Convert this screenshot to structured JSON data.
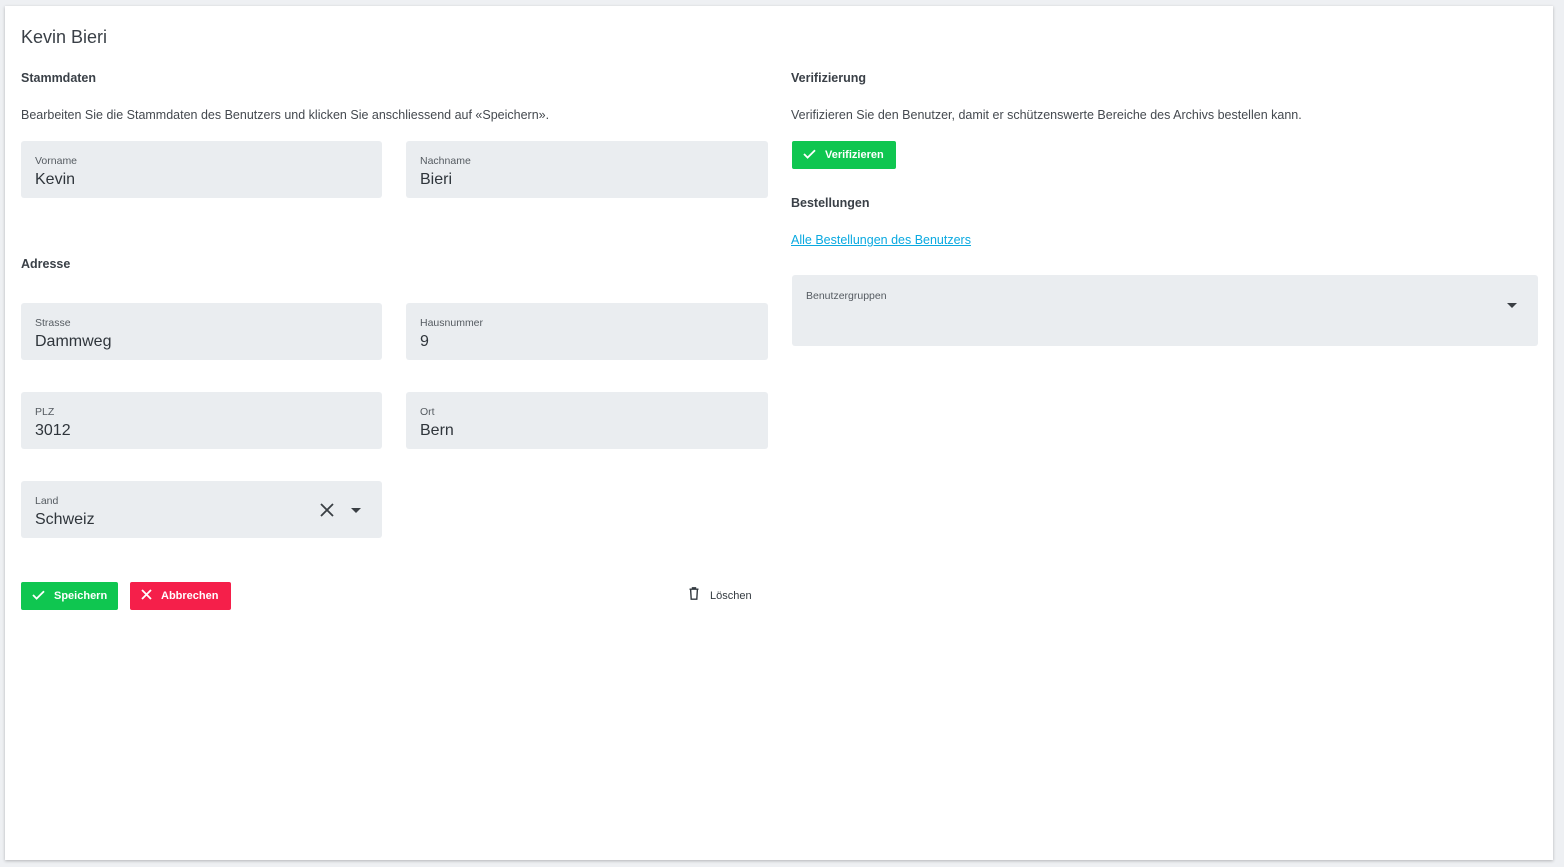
{
  "page": {
    "title": "Kevin Bieri"
  },
  "stammdaten": {
    "heading": "Stammdaten",
    "description": "Bearbeiten Sie die Stammdaten des Benutzers und klicken Sie anschliessend auf «Speichern».",
    "vorname": {
      "label": "Vorname",
      "value": "Kevin"
    },
    "nachname": {
      "label": "Nachname",
      "value": "Bieri"
    }
  },
  "adresse": {
    "heading": "Adresse",
    "strasse": {
      "label": "Strasse",
      "value": "Dammweg"
    },
    "hausnummer": {
      "label": "Hausnummer",
      "value": "9"
    },
    "plz": {
      "label": "PLZ",
      "value": "3012"
    },
    "ort": {
      "label": "Ort",
      "value": "Bern"
    },
    "land": {
      "label": "Land",
      "value": "Schweiz"
    }
  },
  "actions": {
    "save_label": "Speichern",
    "cancel_label": "Abbrechen",
    "delete_label": "Löschen"
  },
  "verifizierung": {
    "heading": "Verifizierung",
    "description": "Verifizieren Sie den Benutzer, damit er schützenswerte Bereiche des Archivs bestellen kann.",
    "button_label": "Verifizieren"
  },
  "bestellungen": {
    "heading": "Bestellungen",
    "link_label": "Alle Bestellungen des Benutzers"
  },
  "benutzergruppen": {
    "label": "Benutzergruppen",
    "value": ""
  },
  "colors": {
    "success": "#0fc650",
    "danger": "#f51f4a",
    "link": "#0aa9e0",
    "field_bg": "#eaedf0"
  },
  "icons": [
    "check-icon",
    "close-icon",
    "trash-icon",
    "chevron-down-icon",
    "clear-icon"
  ]
}
